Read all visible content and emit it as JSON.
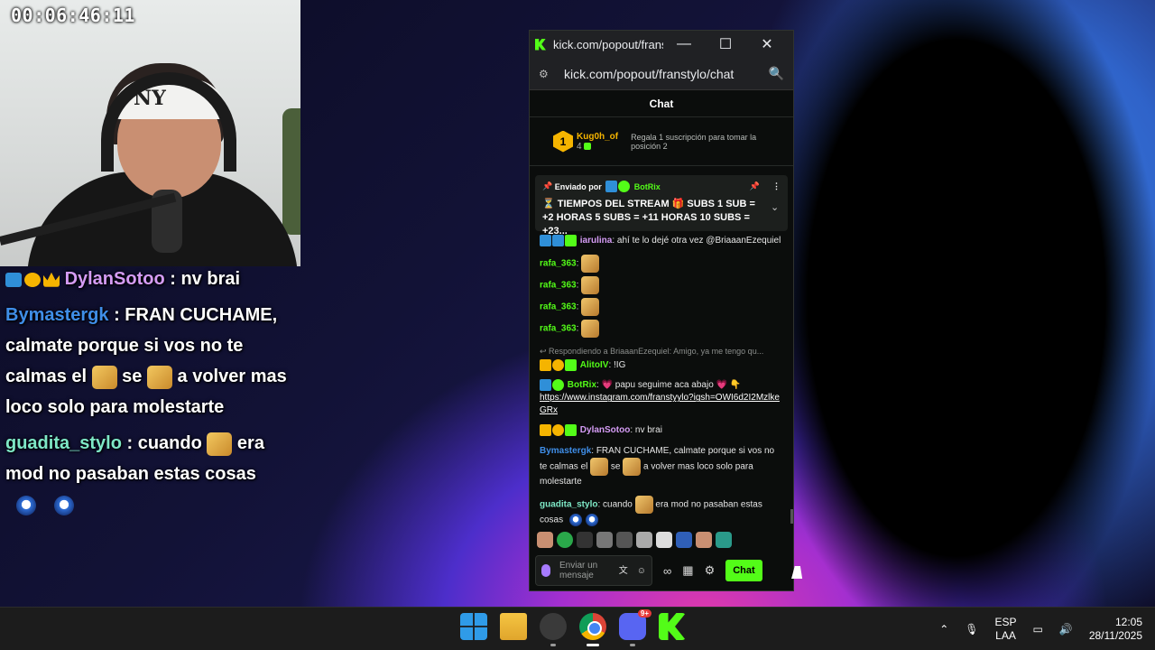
{
  "stream": {
    "timer": "00:06:46:11"
  },
  "overlay": {
    "messages": [
      {
        "user": "DylanSotoo",
        "user_color": "#d59cf5",
        "text": " : nv brai"
      },
      {
        "user": "Bymastergk",
        "user_color": "#3f8ee8",
        "text_a": " : FRAN CUCHAME, calmate porque si vos no te calmas el ",
        "text_b": " se ",
        "text_c": " a volver mas loco solo para molestarte"
      },
      {
        "user": "guadita_stylo",
        "user_color": "#7ee8c6",
        "text_a": " : cuando ",
        "text_b": " era mod no pasaban estas cosas"
      }
    ]
  },
  "window": {
    "title": "kick.com/popout/frans...",
    "url": "kick.com/popout/franstylo/chat",
    "minimize": "—",
    "maximize": "☐",
    "close": "✕",
    "search_icon": "🔍",
    "tune_icon": "⚙"
  },
  "chat": {
    "header": "Chat",
    "leader": {
      "rank": "1",
      "name": "Kug0h_of",
      "count": "4",
      "gift_text": "Regala 1 suscripción para tomar la posición 2"
    },
    "pinned": {
      "sent_by_label": "Enviado por",
      "sender": "BotRix",
      "text": "⏳ TIEMPOS DEL STREAM 🎁 SUBS 1 SUB = +2 HORAS 5 SUBS = +11 HORAS 10 SUBS = +23..."
    },
    "messages": [
      {
        "user": "iarulina",
        "color": "#d59cf5",
        "text": ": ahí te lo dejé otra vez @BriaaanEzequiel"
      },
      {
        "user": "rafa_363",
        "color": "#53fc18",
        "text": ":"
      },
      {
        "user": "rafa_363",
        "color": "#53fc18",
        "text": ":"
      },
      {
        "user": "rafa_363",
        "color": "#53fc18",
        "text": ":"
      },
      {
        "user": "rafa_363",
        "color": "#53fc18",
        "text": ":"
      },
      {
        "reply": "↩ Respondiendo a BriaaanEzequiel: Amigo, ya me tengo qu...",
        "user": "AlitoIV",
        "color": "#53fc18",
        "text": ": !IG"
      },
      {
        "user": "BotRix",
        "color": "#53fc18",
        "text": ": 💗 papu seguime aca abajo 💗 👇",
        "link": "https://www.instagram.com/franstyylo?igsh=OWI6d2I2MzlkeGRx"
      },
      {
        "user": "DylanSotoo",
        "color": "#d59cf5",
        "text": ": nv brai"
      },
      {
        "user": "Bymastergk",
        "color": "#3f8ee8",
        "text_a": ": FRAN CUCHAME, calmate porque si vos no te calmas el ",
        "text_b": " se ",
        "text_c": " a volver mas loco solo para molestarte"
      },
      {
        "user": "guadita_stylo",
        "color": "#7ee8c6",
        "text_a": ": cuando ",
        "text_b": " era mod no pasaban estas cosas"
      }
    ],
    "input_placeholder": "Enviar un mensaje",
    "send_label": "Chat"
  },
  "taskbar": {
    "discord_badge": "9+",
    "language_line1": "ESP",
    "language_line2": "LAA",
    "time": "12:05",
    "date": "28/11/2025"
  },
  "colors": {
    "kick_green": "#53fc18",
    "gold": "#f5b400"
  }
}
